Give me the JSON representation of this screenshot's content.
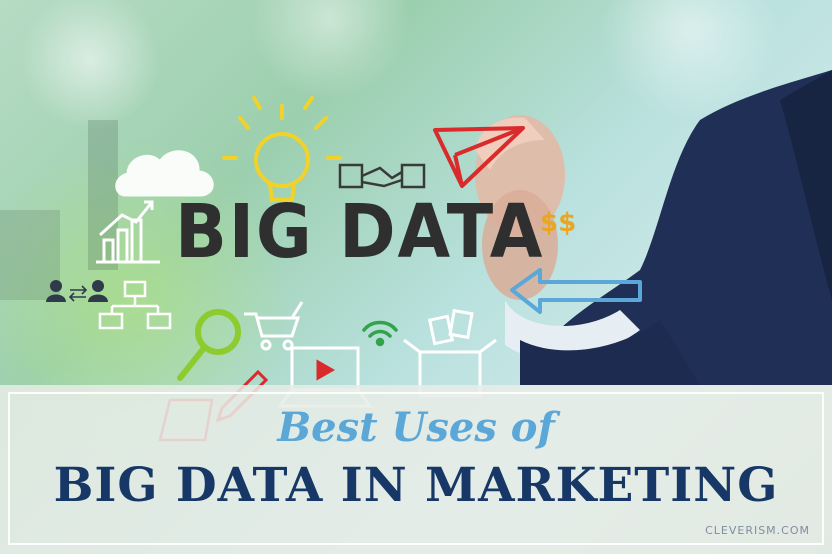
{
  "image": {
    "doodle_text": "BIG DATA",
    "doodle_symbols": "$$",
    "subtitle": "Best Uses of",
    "title": "BIG DATA IN MARKETING",
    "watermark": "CLEVERISM.COM"
  },
  "colors": {
    "title": "#173866",
    "subtitle": "#5aa7d8",
    "accent_red": "#d92b2b",
    "accent_yellow": "#f2d229",
    "suit": "#1f2f55"
  },
  "icons": [
    "cloud-icon",
    "lightbulb-icon",
    "handshake-icon",
    "paper-plane-icon",
    "bar-chart-icon",
    "people-transfer-icon",
    "flowchart-icon",
    "magnifier-icon",
    "shopping-cart-icon",
    "wifi-icon",
    "box-icon",
    "laptop-icon",
    "pencil-icon",
    "arrow-icon"
  ]
}
